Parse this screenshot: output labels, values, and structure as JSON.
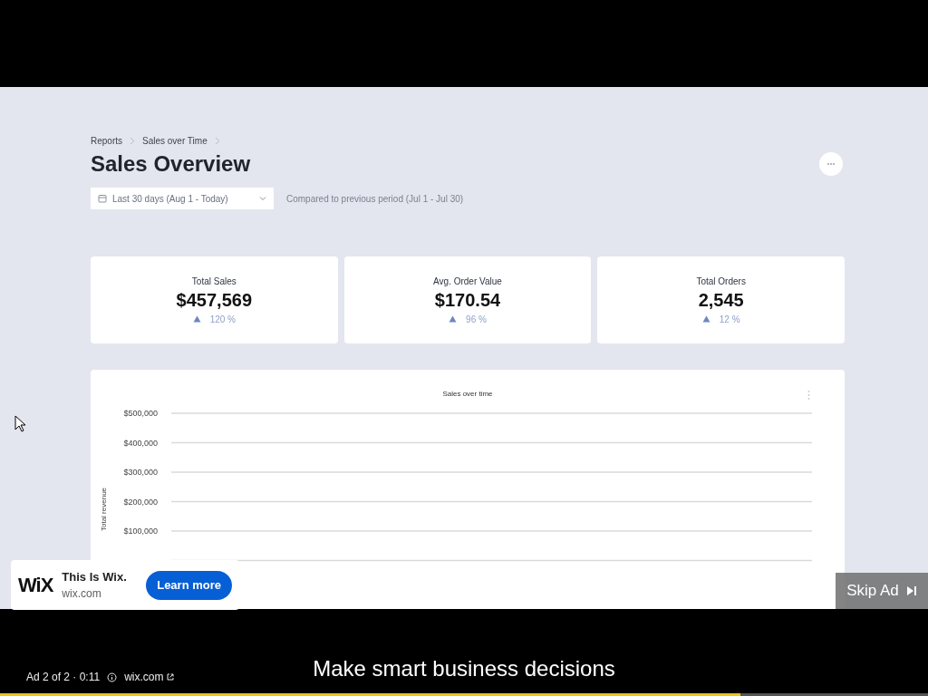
{
  "video": {
    "breadcrumb": [
      {
        "label": "Reports"
      },
      {
        "label": "Sales over Time"
      }
    ],
    "title": "Sales Overview",
    "date_filter": {
      "value": "Last 30 days (Aug 1 - Today)"
    },
    "comparison": "Compared to previous period (Jul 1 - Jul 30)",
    "kpis": [
      {
        "label": "Total Sales",
        "value": "$457,569",
        "change": "120 %"
      },
      {
        "label": "Avg. Order Value",
        "value": "$170.54",
        "change": "96 %"
      },
      {
        "label": "Total Orders",
        "value": "2,545",
        "change": "12 %"
      }
    ],
    "chart": {
      "title": "Sales over time",
      "axis_label": "Total revenue",
      "tick_labels": [
        "$500,000",
        "$400,000",
        "$300,000",
        "$200,000",
        "$100,000"
      ]
    }
  },
  "ad_card": {
    "logo": "WiX",
    "advertiser": "This Is Wix.",
    "domain": "wix.com",
    "button": "Learn more"
  },
  "skip_button": "Skip Ad",
  "caption": "Make smart business decisions",
  "ad_info": {
    "position": "Ad 2 of 2 · 0:11",
    "link": "wix.com"
  },
  "progress": {
    "level": 0.798
  }
}
